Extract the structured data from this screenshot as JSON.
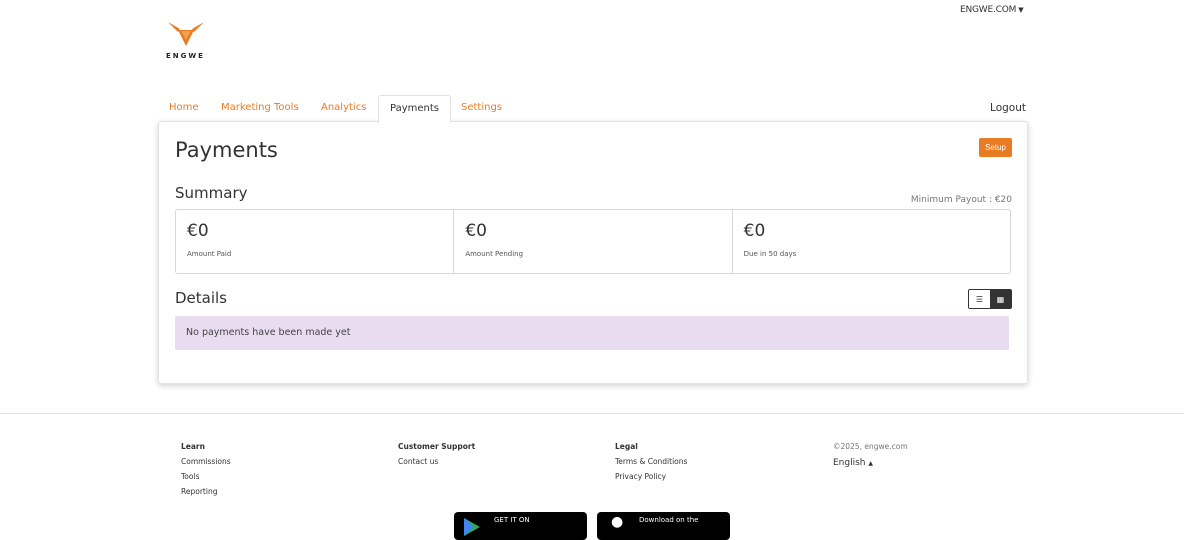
{
  "header": {
    "store": "ENGWE.COM",
    "logo_text": "ENGWE"
  },
  "nav": {
    "tabs": [
      {
        "label": "Home"
      },
      {
        "label": "Marketing Tools"
      },
      {
        "label": "Analytics"
      },
      {
        "label": "Payments",
        "active": true
      },
      {
        "label": "Settings"
      }
    ],
    "logout": "Logout"
  },
  "payments": {
    "title": "Payments",
    "setup": "Setup",
    "summary_title": "Summary",
    "min_payout": "Minimum Payout : €20",
    "summary": [
      {
        "value": "€0",
        "label": "Amount Paid"
      },
      {
        "value": "€0",
        "label": "Amount Pending"
      },
      {
        "value": "€0",
        "label": "Due in 50 days"
      }
    ],
    "details_title": "Details",
    "empty_message": "No payments have been made yet"
  },
  "footer": {
    "learn": {
      "head": "Learn",
      "items": [
        "Commissions",
        "Tools",
        "Reporting"
      ]
    },
    "support": {
      "head": "Customer Support",
      "items": [
        "Contact us"
      ]
    },
    "legal": {
      "head": "Legal",
      "items": [
        "Terms & Conditions",
        "Privacy Policy"
      ]
    },
    "copyright": "©2025, engwe.com",
    "language": "English",
    "badges": {
      "google": "GET IT ON",
      "apple": "Download on the"
    }
  },
  "colors": {
    "accent": "#e87c22",
    "alert_bg": "#e9dcf0"
  }
}
